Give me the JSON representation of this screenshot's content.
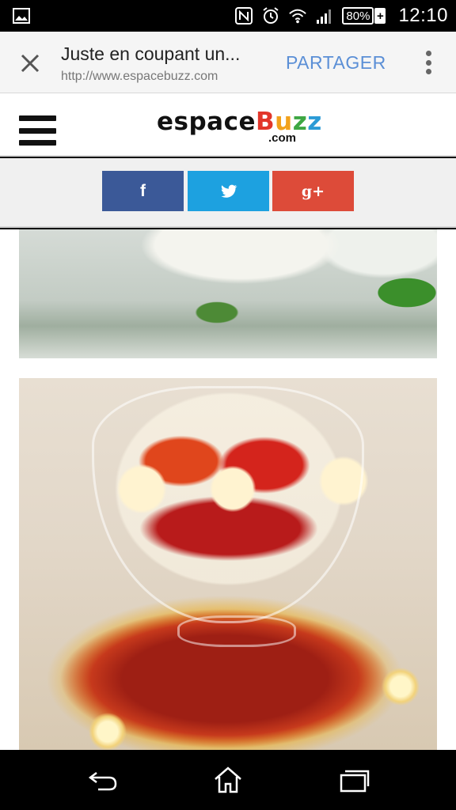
{
  "status_bar": {
    "battery_percent": "80%",
    "battery_charging": "+",
    "time": "12:10",
    "icons": [
      "image-notification-icon",
      "nfc-icon",
      "alarm-icon",
      "wifi-icon",
      "signal-icon",
      "battery-icon"
    ]
  },
  "custom_tab": {
    "title": "Juste en coupant un...",
    "url": "http://www.espacebuzz.com",
    "share_label": "PARTAGER",
    "close_icon": "close-icon",
    "menu_icon": "more-vert-icon"
  },
  "site": {
    "logo_parts": [
      "espace",
      "B",
      "u",
      "z",
      "z"
    ],
    "logo_tld": ".com",
    "menu_icon": "hamburger-icon",
    "colors": {
      "b": "#e2362a",
      "u": "#f2a21c",
      "z1": "#3ea743",
      "z2": "#2b9bd6"
    }
  },
  "share_buttons": [
    {
      "label": "f",
      "network": "facebook",
      "color": "#3b5998"
    },
    {
      "label": "",
      "network": "twitter",
      "color": "#1da1e0"
    },
    {
      "label": "g+",
      "network": "google-plus",
      "color": "#dd4b39"
    }
  ],
  "navigation_bar": {
    "icons": [
      "back-icon",
      "home-icon",
      "recent-apps-icon"
    ]
  }
}
